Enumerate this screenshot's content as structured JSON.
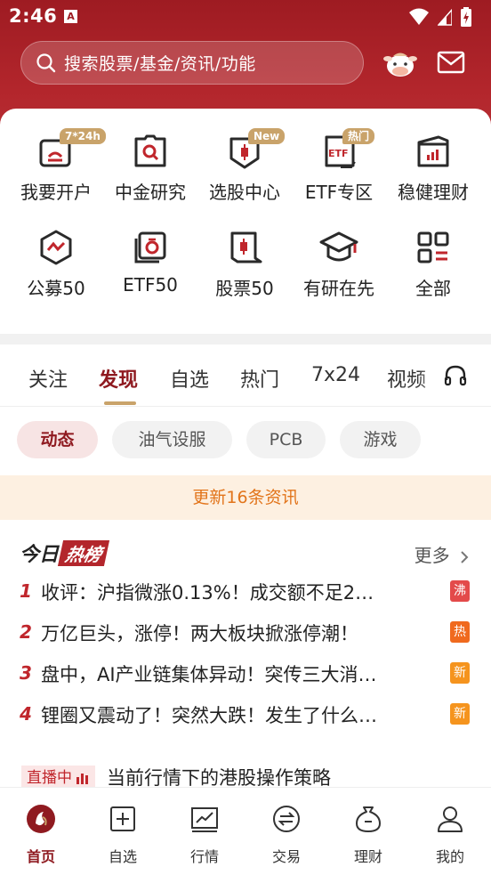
{
  "status_bar": {
    "time": "2:46",
    "notif_glyph": "A"
  },
  "search": {
    "placeholder": "搜索股票/基金/资讯/功能"
  },
  "shortcuts": [
    {
      "label": "我要开户",
      "badge": "7*24h",
      "icon": "account-open-icon"
    },
    {
      "label": "中金研究",
      "badge": "",
      "icon": "research-icon"
    },
    {
      "label": "选股中心",
      "badge": "New",
      "icon": "stock-picker-icon"
    },
    {
      "label": "ETF专区",
      "badge": "热门",
      "icon": "etf-zone-icon"
    },
    {
      "label": "稳健理财",
      "badge": "",
      "icon": "wealth-icon"
    },
    {
      "label": "公募50",
      "badge": "",
      "icon": "fund50-icon"
    },
    {
      "label": "ETF50",
      "badge": "",
      "icon": "etf50-icon"
    },
    {
      "label": "股票50",
      "badge": "",
      "icon": "stock50-icon"
    },
    {
      "label": "有研在先",
      "badge": "",
      "icon": "graduation-icon"
    },
    {
      "label": "全部",
      "badge": "",
      "icon": "all-apps-icon"
    }
  ],
  "tabs": [
    "关注",
    "发现",
    "自选",
    "热门",
    "7x24",
    "视频"
  ],
  "active_tab": "发现",
  "chips": [
    "动态",
    "油气设服",
    "PCB",
    "游戏"
  ],
  "update_banner": "更新16条资讯",
  "hot_list": {
    "title_a": "今日",
    "title_b": "热榜",
    "more": "更多",
    "items": [
      {
        "rank": "1",
        "title": "收评：沪指微涨0.13%！成交额不足2…",
        "tag": "沸",
        "tag_color": "#e34a4a"
      },
      {
        "rank": "2",
        "title": "万亿巨头，涨停！两大板块掀涨停潮！",
        "tag": "热",
        "tag_color": "#f06a1e"
      },
      {
        "rank": "3",
        "title": "盘中，AI产业链集体异动！突传三大消…",
        "tag": "新",
        "tag_color": "#f5941e"
      },
      {
        "rank": "4",
        "title": "锂圈又震动了！突然大跌！发生了什么…",
        "tag": "新",
        "tag_color": "#f5941e"
      }
    ]
  },
  "live": {
    "tag": "直播中",
    "title": "当前行情下的港股操作策略"
  },
  "bottom_nav": [
    "首页",
    "自选",
    "行情",
    "交易",
    "理财",
    "我的"
  ],
  "colors": {
    "brand": "#9e1b22",
    "accent_gold": "#c9a36a",
    "update_text": "#e2741a"
  }
}
